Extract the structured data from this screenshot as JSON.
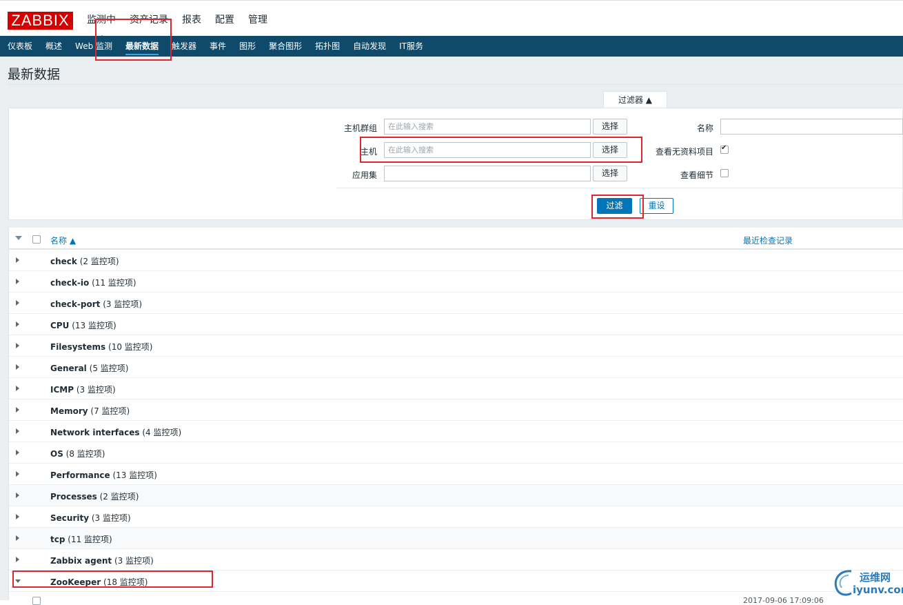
{
  "header": {
    "logo": "ZABBIX",
    "nav": [
      "监测中",
      "资产记录",
      "报表",
      "配置",
      "管理"
    ]
  },
  "subnav": [
    "仪表板",
    "概述",
    "Web 监测",
    "最新数据",
    "触发器",
    "事件",
    "图形",
    "聚合图形",
    "拓扑图",
    "自动发现",
    "IT服务"
  ],
  "page_title": "最新数据",
  "filter": {
    "tab_label": "过滤器 ▲",
    "host_group_label": "主机群组",
    "host_group_placeholder": "在此输入搜索",
    "host_label": "主机",
    "host_placeholder": "在此输入搜索",
    "application_label": "应用集",
    "application_value": "",
    "select_label": "选择",
    "name_label": "名称",
    "name_value": "",
    "show_no_data_label": "查看无资料项目",
    "show_no_data_checked": true,
    "show_details_label": "查看细节",
    "show_details_checked": false,
    "apply_label": "过滤",
    "reset_label": "重设"
  },
  "table": {
    "col_name": "名称 ▲",
    "col_last_check": "最近检查记录",
    "rows": [
      {
        "name": "check",
        "count": "(2 监控项)"
      },
      {
        "name": "check-io",
        "count": "(11 监控项)"
      },
      {
        "name": "check-port",
        "count": "(3 监控项)"
      },
      {
        "name": "CPU",
        "count": "(13 监控项)"
      },
      {
        "name": "Filesystems",
        "count": "(10 监控项)"
      },
      {
        "name": "General",
        "count": "(5 监控项)"
      },
      {
        "name": "ICMP",
        "count": "(3 监控项)"
      },
      {
        "name": "Memory",
        "count": "(7 监控项)"
      },
      {
        "name": "Network interfaces",
        "count": "(4 监控项)"
      },
      {
        "name": "OS",
        "count": "(8 监控项)"
      },
      {
        "name": "Performance",
        "count": "(13 监控项)"
      },
      {
        "name": "Processes",
        "count": "(2 监控项)"
      },
      {
        "name": "Security",
        "count": "(3 监控项)"
      },
      {
        "name": "tcp",
        "count": "(11 监控项)"
      },
      {
        "name": "Zabbix agent",
        "count": "(3 监控项)"
      },
      {
        "name": "ZooKeeper",
        "count": "(18 监控项)"
      }
    ],
    "partial_row_time": "2017-09-06 17:09:06"
  },
  "watermark": {
    "line1": "运维网",
    "line2": "iyunv.com"
  }
}
